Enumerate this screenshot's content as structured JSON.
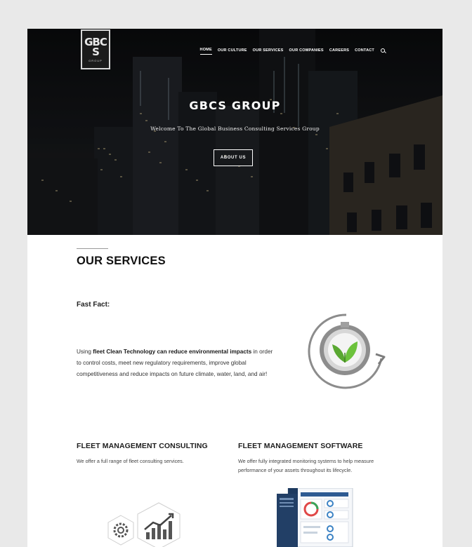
{
  "logo": {
    "mark": "GBCS",
    "sub": "GROUP"
  },
  "nav": {
    "items": [
      "HOME",
      "OUR CULTURE",
      "OUR SERVICES",
      "OUR COMPANIES",
      "CAREERS",
      "CONTACT"
    ],
    "active": "HOME"
  },
  "hero": {
    "title": "GBCS GROUP",
    "subtitle": "Welcome To The Global Business Consulting Services Group",
    "button_label": "ABOUT US"
  },
  "services": {
    "heading": "OUR SERVICES",
    "fast_fact_label": "Fast Fact:",
    "fact_prefix": "Using ",
    "fact_bold": "fleet Clean Technology can reduce environmental impacts",
    "fact_suffix": " in order to control costs, meet new regulatory requirements, improve global competitiveness and reduce impacts on future climate, water, land, and air!"
  },
  "columns": [
    {
      "title": "FLEET MANAGEMENT CONSULTING",
      "text": "We offer a full range of fleet consulting services."
    },
    {
      "title": "FLEET MANAGEMENT SOFTWARE",
      "text": "We offer fully integrated monitoring systems to help measure performance of your assets throughout its lifecycle."
    }
  ],
  "icons": {
    "search": "search-icon",
    "clock": "clock-leaf-icon",
    "hex": "gear-chart-hexagon-icon",
    "dashboard": "dashboard-screenshot"
  },
  "colors": {
    "accent_green": "#5aa832",
    "hero_dark": "#0b0c0e"
  }
}
